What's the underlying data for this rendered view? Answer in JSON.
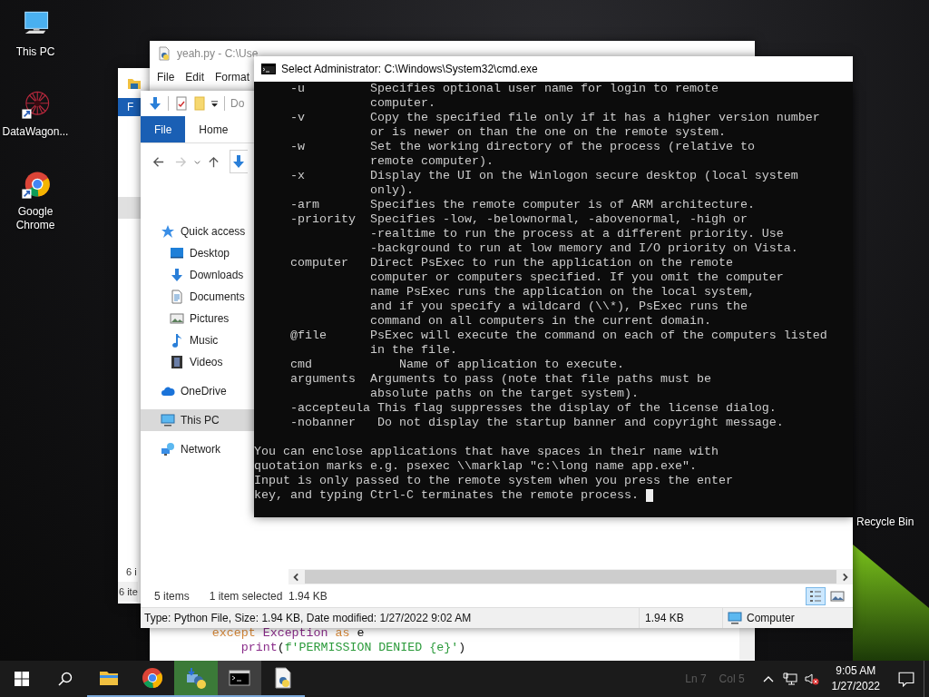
{
  "desktop_icons": [
    {
      "kind": "pc",
      "label": "This PC"
    },
    {
      "kind": "datawagon",
      "label": "DataWagon..."
    },
    {
      "kind": "chrome",
      "label": "Google Chrome"
    }
  ],
  "recycle_bin": {
    "label": "Recycle Bin"
  },
  "back_explorer": {
    "ribbon_tab": "F",
    "status_texts": [
      "6 i",
      "6 ite"
    ]
  },
  "notepad": {
    "title": "yeah.py - C:\\Use",
    "menu": [
      "File",
      "Edit",
      "Format"
    ],
    "code": [
      [
        {
          "kind": "keyword",
          "text": "        except"
        },
        {
          "kind": "builtin",
          "text": " Exception"
        },
        {
          "kind": "keyword",
          "text": " as"
        },
        {
          "kind": "plain",
          "text": " e"
        }
      ],
      [
        {
          "kind": "builtin",
          "text": "            print"
        },
        {
          "kind": "plain",
          "text": "("
        },
        {
          "kind": "string",
          "text": "f'PERMISSION DENIED {e}'"
        },
        {
          "kind": "plain",
          "text": ")"
        }
      ]
    ],
    "status": [
      "Ln 7",
      "Col 5"
    ]
  },
  "explorer": {
    "toolbar_text": "Do",
    "ribbon_tabs": [
      {
        "label": "File",
        "selected": true
      },
      {
        "label": "Home",
        "selected": false
      }
    ],
    "nav": [
      {
        "kind": "star",
        "label": "Quick access",
        "selected": false,
        "children": [
          {
            "kind": "desktop",
            "label": "Desktop",
            "selected": false
          },
          {
            "kind": "download",
            "label": "Downloads",
            "selected": false
          },
          {
            "kind": "document",
            "label": "Documents",
            "selected": false
          },
          {
            "kind": "picture",
            "label": "Pictures",
            "selected": false
          },
          {
            "kind": "music",
            "label": "Music",
            "selected": false
          },
          {
            "kind": "video",
            "label": "Videos",
            "selected": false
          }
        ]
      },
      {
        "kind": "cloud",
        "label": "OneDrive",
        "selected": false
      },
      {
        "kind": "pc",
        "label": "This PC",
        "selected": true
      },
      {
        "kind": "network",
        "label": "Network",
        "selected": false
      }
    ],
    "status": {
      "count": "5 items",
      "selection": "1 item selected  1.94 KB"
    },
    "views": [
      {
        "kind": "details",
        "selected": true
      },
      {
        "kind": "preview",
        "selected": false
      }
    ],
    "details": {
      "info": "Type: Python File, Size: 1.94 KB, Date modified: 1/27/2022 9:02 AM",
      "size": "1.94 KB",
      "location": "Computer"
    }
  },
  "cmd": {
    "title": "Select Administrator: C:\\Windows\\System32\\cmd.exe",
    "cursor": true,
    "blocks": [
      {
        "lines": [
          "     -u         Specifies optional user name for login to remote",
          "                computer.",
          "     -v         Copy the specified file only if it has a higher version number",
          "                or is newer on than the one on the remote system.",
          "     -w         Set the working directory of the process (relative to",
          "                remote computer).",
          "     -x         Display the UI on the Winlogon secure desktop (local system",
          "                only).",
          "     -arm       Specifies the remote computer is of ARM architecture.",
          "     -priority  Specifies -low, -belownormal, -abovenormal, -high or",
          "                -realtime to run the process at a different priority. Use",
          "                -background to run at low memory and I/O priority on Vista.",
          "     computer   Direct PsExec to run the application on the remote",
          "                computer or computers specified. If you omit the computer",
          "                name PsExec runs the application on the local system,",
          "                and if you specify a wildcard (\\\\*), PsExec runs the",
          "                command on all computers in the current domain.",
          "     @file      PsExec will execute the command on each of the computers listed",
          "                in the file.",
          "     cmd            Name of application to execute.",
          "     arguments  Arguments to pass (note that file paths must be",
          "                absolute paths on the target system).",
          "     -accepteula This flag suppresses the display of the license dialog.",
          "     -nobanner   Do not display the startup banner and copyright message."
        ]
      },
      {
        "lines": [
          "You can enclose applications that have spaces in their name with",
          "quotation marks e.g. psexec \\\\marklap \"c:\\long name app.exe\".",
          "Input is only passed to the remote system when you press the enter",
          "key, and typing Ctrl-C terminates the remote process."
        ]
      }
    ]
  },
  "taskbar": {
    "apps": [
      {
        "kind": "explorer",
        "selected": false,
        "flashing": false
      },
      {
        "kind": "chrome",
        "selected": false,
        "flashing": false
      },
      {
        "kind": "python-setup",
        "selected": false,
        "flashing": true
      },
      {
        "kind": "cmd",
        "selected": true,
        "flashing": false
      },
      {
        "kind": "notepad-python",
        "selected": false,
        "flashing": false
      }
    ],
    "time": "9:05 AM",
    "date": "1/27/2022"
  }
}
